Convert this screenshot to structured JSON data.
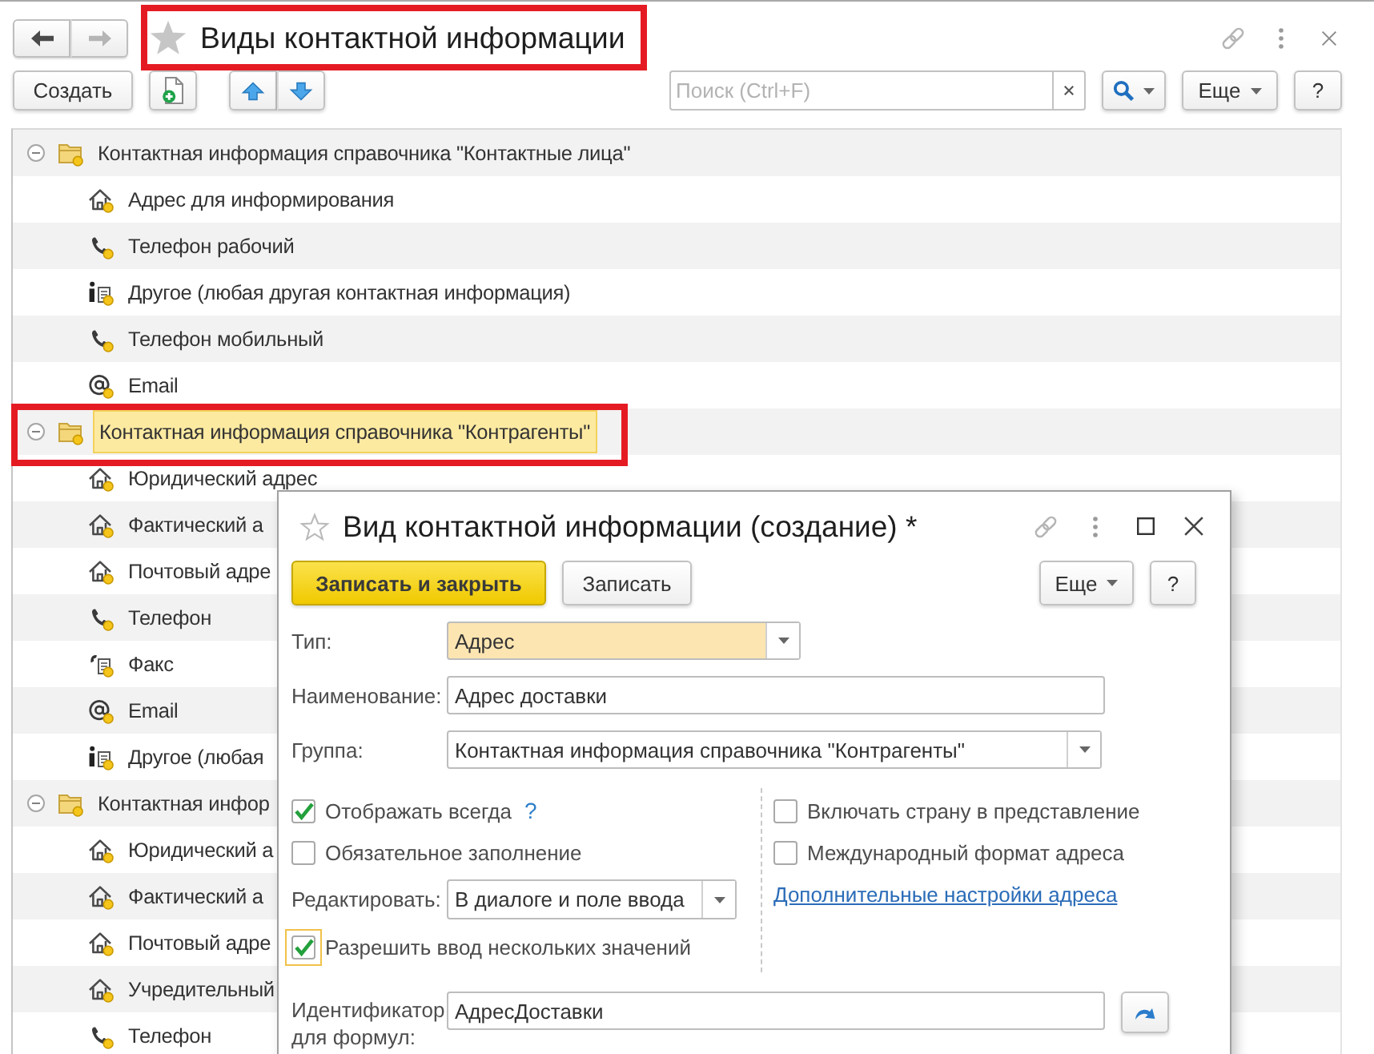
{
  "window": {
    "title": "Виды контактной информации",
    "highlighted": true
  },
  "navigation": {
    "back": {
      "disabled": false
    },
    "forward": {
      "disabled": true
    }
  },
  "toolbar": {
    "create_button": "Создать",
    "search": {
      "placeholder": "Поиск (Ctrl+F)"
    },
    "more_button": "Еще",
    "help_button": "?"
  },
  "tree": [
    {
      "label": "Контактная информация справочника \"Контактные лица\"",
      "expanded": true,
      "selected": false,
      "highlighted": false,
      "children": [
        {
          "label": "Адрес для информирования",
          "kind": "address",
          "selected": false
        },
        {
          "label": "Телефон рабочий",
          "kind": "phone",
          "selected": false
        },
        {
          "label": "Другое (любая другая контактная информация)",
          "kind": "other",
          "selected": false
        },
        {
          "label": "Телефон мобильный",
          "kind": "phone",
          "selected": false
        },
        {
          "label": "Email",
          "kind": "email",
          "selected": false
        }
      ]
    },
    {
      "label": "Контактная информация справочника \"Контрагенты\"",
      "expanded": true,
      "selected": true,
      "highlighted": true,
      "children": [
        {
          "label": "Юридический адрес",
          "kind": "address",
          "selected": false
        },
        {
          "label": "Фактический а",
          "kind": "address",
          "selected": false
        },
        {
          "label": "Почтовый адре",
          "kind": "address",
          "selected": false
        },
        {
          "label": "Телефон",
          "kind": "phone",
          "selected": false
        },
        {
          "label": "Факс",
          "kind": "fax",
          "selected": false
        },
        {
          "label": "Email",
          "kind": "email",
          "selected": false
        },
        {
          "label": "Другое (любая",
          "kind": "other",
          "selected": false
        }
      ]
    },
    {
      "label": "Контактная инфор",
      "expanded": true,
      "selected": false,
      "highlighted": false,
      "children": [
        {
          "label": "Юридический а",
          "kind": "address",
          "selected": false
        },
        {
          "label": "Фактический а",
          "kind": "address",
          "selected": false
        },
        {
          "label": "Почтовый адре",
          "kind": "address",
          "selected": false
        },
        {
          "label": "Учредительный",
          "kind": "address",
          "selected": false
        },
        {
          "label": "Телефон",
          "kind": "phone",
          "selected": false
        }
      ]
    }
  ],
  "dialog": {
    "title": "Вид контактной информации (создание) *",
    "buttons": [
      {
        "label": "Записать и закрыть",
        "default": true
      },
      {
        "label": "Записать",
        "default": false
      }
    ],
    "more_button": "Еще",
    "help_button": "?",
    "type": {
      "label": "Тип:",
      "value": "Адрес",
      "highlighted": true
    },
    "name": {
      "label": "Наименование:",
      "value": "Адрес доставки"
    },
    "group": {
      "label": "Группа:",
      "value": "Контактная информация справочника \"Контрагенты\""
    },
    "left_options": [
      {
        "label": "Отображать всегда",
        "checked": true,
        "hint": "?"
      },
      {
        "label": "Обязательное заполнение",
        "checked": false
      }
    ],
    "edit_mode": {
      "label": "Редактировать:",
      "value": "В диалоге и поле ввода"
    },
    "multiple_values": {
      "label": "Разрешить ввод нескольких значений",
      "checked": true,
      "focused": true
    },
    "right_options": [
      {
        "label": "Включать страну в представление",
        "checked": false
      },
      {
        "label": "Международный формат адреса",
        "checked": false
      }
    ],
    "settings_link": "Дополнительные настройки адреса",
    "identifier": {
      "label": "Идентификатор для формул:",
      "value": "АдресДоставки"
    }
  }
}
